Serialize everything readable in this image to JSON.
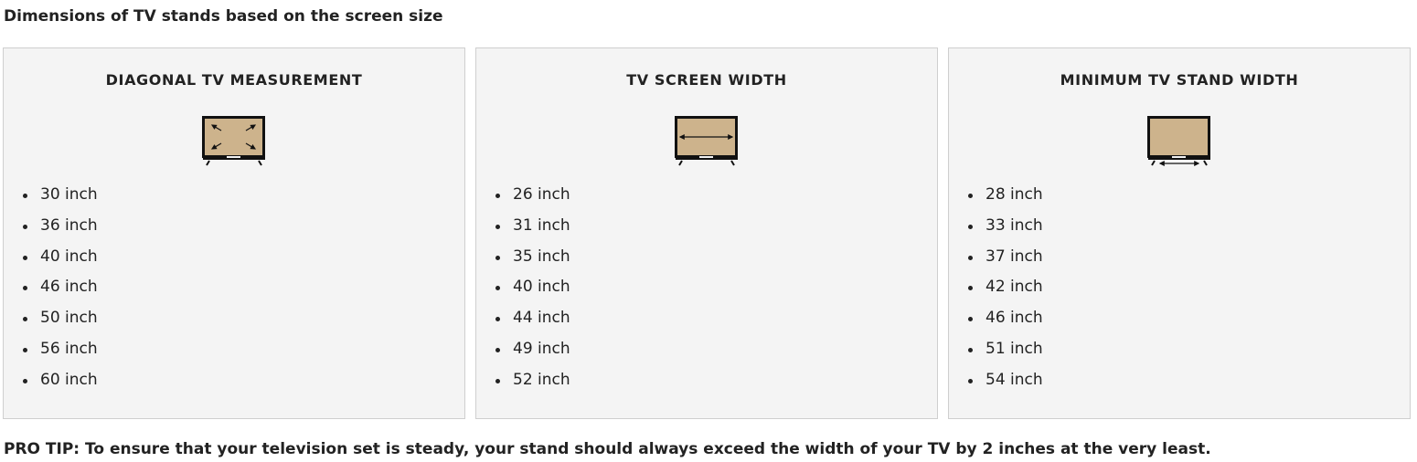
{
  "title": "Dimensions of TV stands based on the screen size",
  "colors": {
    "panel_background": "#f4f4f4",
    "panel_border": "#cfcfcf",
    "tv_screen_fill": "#cdb38c",
    "tv_frame": "#111111"
  },
  "panels": [
    {
      "title": "DIAGONAL TV MEASUREMENT",
      "icon": "tv-diagonal-arrows-icon",
      "items": [
        "30 inch",
        "36 inch",
        "40 inch",
        "46 inch",
        "50 inch",
        "56 inch",
        "60 inch"
      ]
    },
    {
      "title": "TV SCREEN WIDTH",
      "icon": "tv-screen-width-icon",
      "items": [
        "26 inch",
        "31 inch",
        "35 inch",
        "40 inch",
        "44 inch",
        "49 inch",
        "52 inch"
      ]
    },
    {
      "title": "MINIMUM TV STAND WIDTH",
      "icon": "tv-stand-width-icon",
      "items": [
        "28 inch",
        "33 inch",
        "37 inch",
        "42 inch",
        "46 inch",
        "51 inch",
        "54 inch"
      ]
    }
  ],
  "pro_tip": "PRO TIP: To ensure that your television set is steady, your stand should always exceed the width of your TV by 2 inches at the very least."
}
